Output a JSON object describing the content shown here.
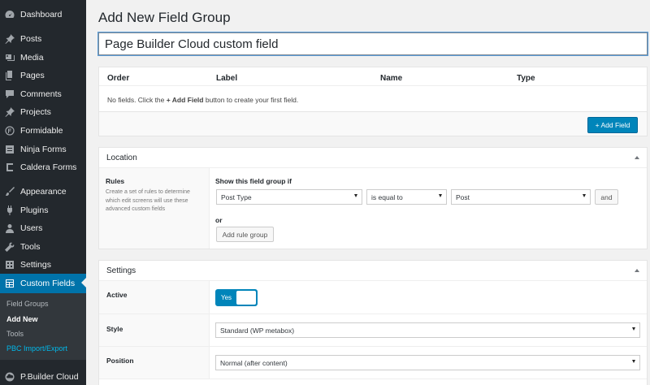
{
  "sidebar": {
    "items": [
      {
        "label": "Dashboard",
        "icon": "dashboard-icon"
      },
      {
        "label": "Posts",
        "icon": "pin-icon"
      },
      {
        "label": "Media",
        "icon": "media-icon"
      },
      {
        "label": "Pages",
        "icon": "pages-icon"
      },
      {
        "label": "Comments",
        "icon": "comments-icon"
      },
      {
        "label": "Projects",
        "icon": "pin-icon"
      },
      {
        "label": "Formidable",
        "icon": "formidable-icon"
      },
      {
        "label": "Ninja Forms",
        "icon": "ninja-forms-icon"
      },
      {
        "label": "Caldera Forms",
        "icon": "caldera-icon"
      },
      {
        "label": "Appearance",
        "icon": "brush-icon"
      },
      {
        "label": "Plugins",
        "icon": "plugin-icon"
      },
      {
        "label": "Users",
        "icon": "users-icon"
      },
      {
        "label": "Tools",
        "icon": "wrench-icon"
      },
      {
        "label": "Settings",
        "icon": "settings-icon"
      },
      {
        "label": "Custom Fields",
        "icon": "custom-fields-icon"
      },
      {
        "label": "P.Builder Cloud",
        "icon": "cloud-icon"
      }
    ],
    "submenu": [
      "Field Groups",
      "Add New",
      "Tools",
      "PBC Import/Export"
    ]
  },
  "page": {
    "title": "Add New Field Group",
    "group_title_value": "Page Builder Cloud custom field"
  },
  "fields": {
    "columns": [
      "Order",
      "Label",
      "Name",
      "Type"
    ],
    "empty_prefix": "No fields. Click the ",
    "empty_bold": "+ Add Field",
    "empty_suffix": " button to create your first field.",
    "add_button": "+ Add Field"
  },
  "location": {
    "title": "Location",
    "rules_label": "Rules",
    "rules_desc": "Create a set of rules to determine which edit screens will use these advanced custom fields",
    "show_if": "Show this field group if",
    "param": "Post Type",
    "operator": "is equal to",
    "value": "Post",
    "and_button": "and",
    "or_label": "or",
    "add_group_button": "Add rule group"
  },
  "settings": {
    "title": "Settings",
    "active_label": "Active",
    "active_value": "Yes",
    "style_label": "Style",
    "style_value": "Standard (WP metabox)",
    "position_label": "Position",
    "position_value": "Normal (after content)"
  },
  "colors": {
    "sidebar_bg": "#23282d",
    "active_bg": "#0073aa",
    "primary_button": "#0085ba",
    "link": "#00b9eb"
  }
}
